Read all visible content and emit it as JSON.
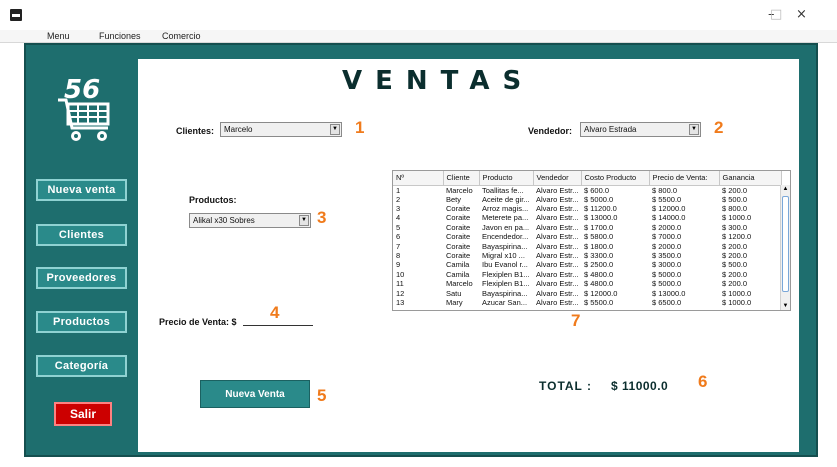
{
  "window": {
    "minimize_glyph": "–",
    "maximize_glyph": "□",
    "close_glyph": "×"
  },
  "menubar": {
    "items": [
      "Menu",
      "Funciones",
      "Comercio"
    ]
  },
  "logo": {
    "number": "56"
  },
  "sidebar": {
    "buttons": [
      "Nueva venta",
      "Clientes",
      "Proveedores",
      "Productos",
      "Categoría"
    ],
    "exit_label": "Salir"
  },
  "title": "VENTAS",
  "clientes": {
    "label": "Clientes:",
    "value": "Marcelo"
  },
  "vendedor": {
    "label": "Vendedor:",
    "value": "Alvaro Estrada"
  },
  "productos": {
    "label": "Productos:",
    "value": "Alikal x30 Sobres"
  },
  "precio": {
    "label": "Precio de Venta: $",
    "value": ""
  },
  "nueva_venta_button": "Nueva Venta",
  "total": {
    "label": "TOTAL :",
    "value": "$ 11000.0"
  },
  "markers": [
    "1",
    "2",
    "3",
    "4",
    "5",
    "6",
    "7"
  ],
  "table": {
    "columns": [
      "Nº",
      "Cliente",
      "Producto",
      "Vendedor",
      "Costo Producto",
      "Precio de Venta:",
      "Ganancia"
    ],
    "rows": [
      [
        "1",
        "Marcelo",
        "Toallitas fe...",
        "Alvaro Estr...",
        "$ 600.0",
        "$ 800.0",
        "$ 200.0"
      ],
      [
        "2",
        "Bety",
        "Aceite de gir...",
        "Alvaro Estr...",
        "$ 5000.0",
        "$ 5500.0",
        "$ 500.0"
      ],
      [
        "3",
        "Coraite",
        "Arroz magis...",
        "Alvaro Estr...",
        "$ 11200.0",
        "$ 12000.0",
        "$ 800.0"
      ],
      [
        "4",
        "Coraite",
        "Meterete pa...",
        "Alvaro Estr...",
        "$ 13000.0",
        "$ 14000.0",
        "$ 1000.0"
      ],
      [
        "5",
        "Coraite",
        "Javon en pa...",
        "Alvaro Estr...",
        "$ 1700.0",
        "$ 2000.0",
        "$ 300.0"
      ],
      [
        "6",
        "Coraite",
        "Encendedor...",
        "Alvaro Estr...",
        "$ 5800.0",
        "$ 7000.0",
        "$ 1200.0"
      ],
      [
        "7",
        "Coraite",
        "Bayaspirina...",
        "Alvaro Estr...",
        "$ 1800.0",
        "$ 2000.0",
        "$ 200.0"
      ],
      [
        "8",
        "Coraite",
        "Migral x10 ...",
        "Alvaro Estr...",
        "$ 3300.0",
        "$ 3500.0",
        "$ 200.0"
      ],
      [
        "9",
        "Camila",
        "Ibu Evanol r...",
        "Alvaro Estr...",
        "$ 2500.0",
        "$ 3000.0",
        "$ 500.0"
      ],
      [
        "10",
        "Camila",
        "Flexiplen B1...",
        "Alvaro Estr...",
        "$ 4800.0",
        "$ 5000.0",
        "$ 200.0"
      ],
      [
        "11",
        "Marcelo",
        "Flexiplen B1...",
        "Alvaro Estr...",
        "$ 4800.0",
        "$ 5000.0",
        "$ 200.0"
      ],
      [
        "12",
        "Satu",
        "Bayaspirina...",
        "Alvaro Estr...",
        "$ 12000.0",
        "$ 13000.0",
        "$ 1000.0"
      ],
      [
        "13",
        "Mary",
        "Azucar San...",
        "Alvaro Estr...",
        "$ 5500.0",
        "$ 6500.0",
        "$ 1000.0"
      ]
    ]
  },
  "colors": {
    "frame": "#1e6e6e",
    "button": "#2a8a8a",
    "exit": "#cc0000",
    "marker": "#f07b1c",
    "title": "#0b2e2e"
  }
}
